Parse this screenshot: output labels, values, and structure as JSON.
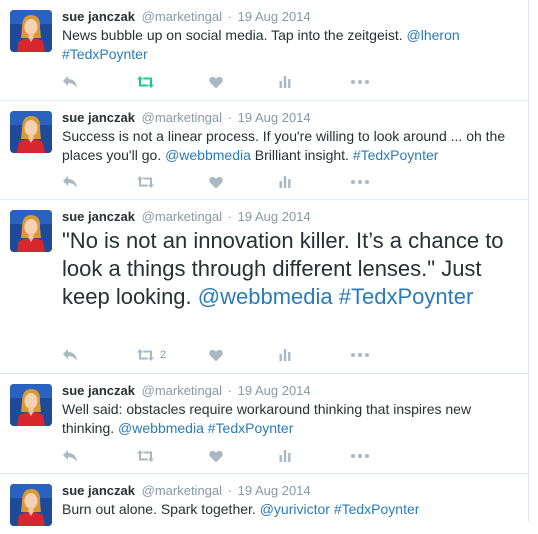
{
  "colors": {
    "link": "#2b7bb9",
    "muted": "#8899a6",
    "retweet_active": "#19cf86",
    "border": "#e1e8ed"
  },
  "icons": [
    "reply-icon",
    "retweet-icon",
    "heart-icon",
    "analytics-icon",
    "more-icon"
  ],
  "tweets": [
    {
      "name": "sue janczak",
      "handle": "@marketingal",
      "separator": "·",
      "date": "19 Aug 2014",
      "parts": [
        {
          "t": "News bubble up on social media. Tap into the zeitgeist. "
        },
        {
          "t": "@lheron",
          "link": true
        },
        {
          "t": " "
        },
        {
          "t": "#TedxPoynter",
          "link": true
        }
      ],
      "retweeted": true,
      "retweet_count": ""
    },
    {
      "name": "sue janczak",
      "handle": "@marketingal",
      "separator": "·",
      "date": "19 Aug 2014",
      "parts": [
        {
          "t": "Success is not a linear process. If you're willing to look around ... oh the places you'll go. "
        },
        {
          "t": "@webbmedia",
          "link": true
        },
        {
          "t": " Brilliant insight. "
        },
        {
          "t": "#TedxPoynter",
          "link": true
        }
      ],
      "retweeted": false,
      "retweet_count": ""
    },
    {
      "name": "sue janczak",
      "handle": "@marketingal",
      "separator": "·",
      "date": "19 Aug 2014",
      "large": true,
      "parts": [
        {
          "t": "\"No is not an innovation killer. It’s a chance to look a things through different lenses.\" Just keep looking. "
        },
        {
          "t": "@webbmedia",
          "link": true
        },
        {
          "t": " "
        },
        {
          "t": "#TedxPoynter",
          "link": true
        }
      ],
      "retweeted": false,
      "retweet_count": "2"
    },
    {
      "name": "sue janczak",
      "handle": "@marketingal",
      "separator": "·",
      "date": "19 Aug 2014",
      "parts": [
        {
          "t": "Well said: obstacles require workaround thinking that inspires new thinking. "
        },
        {
          "t": "@webbmedia",
          "link": true
        },
        {
          "t": " "
        },
        {
          "t": "#TedxPoynter",
          "link": true
        }
      ],
      "retweeted": false,
      "retweet_count": ""
    },
    {
      "name": "sue janczak",
      "handle": "@marketingal",
      "separator": "·",
      "date": "19 Aug 2014",
      "parts": [
        {
          "t": "Burn out alone. Spark together. "
        },
        {
          "t": "@yurivictor",
          "link": true
        },
        {
          "t": " "
        },
        {
          "t": "#TedxPoynter",
          "link": true
        }
      ],
      "retweeted": false,
      "retweet_count": ""
    }
  ]
}
